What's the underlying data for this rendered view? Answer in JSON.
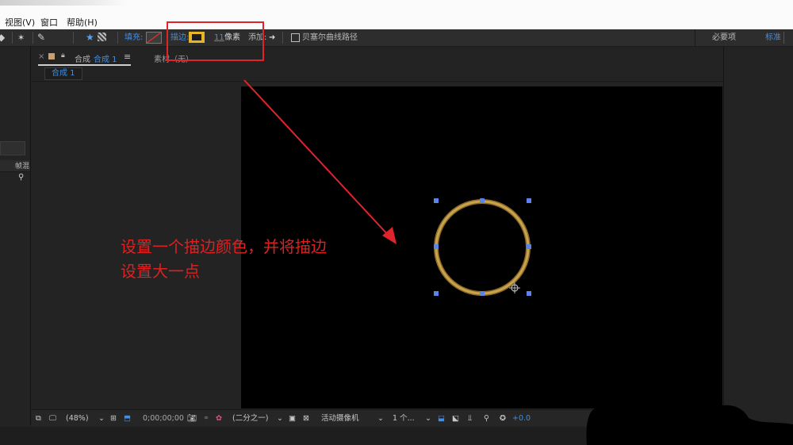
{
  "menu": {
    "items": [
      "视图(V)",
      "窗口",
      "帮助(H)"
    ]
  },
  "toolbar": {
    "fill_label": "填充:",
    "stroke_label": "描边:",
    "stroke_color": "#e8b428",
    "stroke_width": "11",
    "stroke_unit": "像素",
    "add_label": "添加:",
    "bezier_label": "贝塞尔曲线路径",
    "workspace_essentials": "必要项",
    "workspace_standard": "标准"
  },
  "left_panel": {
    "frame_label": "帧混"
  },
  "comp_panel": {
    "tab_prefix": "合成",
    "tab_name": "合成 1",
    "menu_glyph": "≡",
    "footage_tab": "素材（无）",
    "subtab": "合成 1"
  },
  "canvas": {
    "background": "#000000",
    "shape_stroke": "#caa24a"
  },
  "viewer_bar": {
    "magnification": "(48%)",
    "timecode": "0;00;00;00",
    "resolution": "(二分之一)",
    "camera": "活动摄像机",
    "views": "1 个...",
    "exposure": "+0.0"
  },
  "annotation": {
    "line1": "设置一个描边颜色，并将描边",
    "line2": "设置大一点",
    "color": "#e02020"
  }
}
